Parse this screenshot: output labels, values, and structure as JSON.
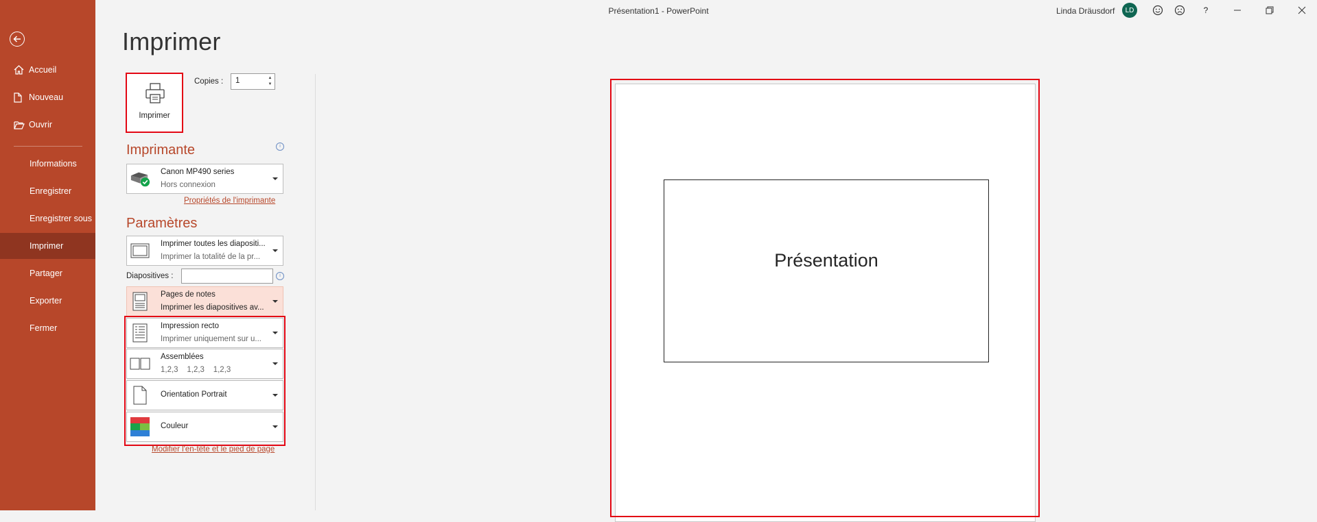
{
  "window": {
    "title": "Présentation1  -  PowerPoint",
    "user_name": "Linda Dräusdorf",
    "user_initials": "LD",
    "help_label": "?"
  },
  "sidebar": {
    "back_icon": "back-arrow-icon",
    "items": [
      {
        "label": "Accueil",
        "icon": "home-icon"
      },
      {
        "label": "Nouveau",
        "icon": "new-document-icon"
      },
      {
        "label": "Ouvrir",
        "icon": "folder-open-icon"
      },
      {
        "label": "Informations"
      },
      {
        "label": "Enregistrer"
      },
      {
        "label": "Enregistrer sous"
      },
      {
        "label": "Imprimer",
        "selected": true
      },
      {
        "label": "Partager"
      },
      {
        "label": "Exporter"
      },
      {
        "label": "Fermer"
      }
    ]
  },
  "print": {
    "title": "Imprimer",
    "print_button_label": "Imprimer",
    "copies_label": "Copies :",
    "copies_value": "1",
    "printer_section_title": "Imprimante",
    "printer_name": "Canon MP490 series",
    "printer_status": "Hors connexion",
    "printer_properties_link": "Propriétés de l'imprimante",
    "settings_section_title": "Paramètres",
    "slides_label": "Diapositives :",
    "slides_value": "",
    "footer_link": "Modifier l'en-tête et le pied de page",
    "settings": [
      {
        "line1": "Imprimer toutes les diapositi...",
        "line2": "Imprimer la totalité de la pr...",
        "icon": "slides-icon"
      },
      {
        "line1": "Pages de notes",
        "line2": "Imprimer les diapositives av...",
        "icon": "notes-page-icon"
      },
      {
        "line1": "Impression recto",
        "line2": "Imprimer uniquement sur u...",
        "icon": "one-sided-icon"
      },
      {
        "line1": "Assemblées",
        "line2": "1,2,3    1,2,3    1,2,3",
        "icon": "collated-icon"
      },
      {
        "line1": "Orientation Portrait",
        "icon": "portrait-page-icon"
      },
      {
        "line1": "Couleur",
        "icon": "color-icon"
      }
    ]
  },
  "preview": {
    "slide_title": "Présentation"
  },
  "colors": {
    "accent": "#b7472a",
    "highlight_border": "#e30613",
    "avatar": "#0f6652"
  }
}
